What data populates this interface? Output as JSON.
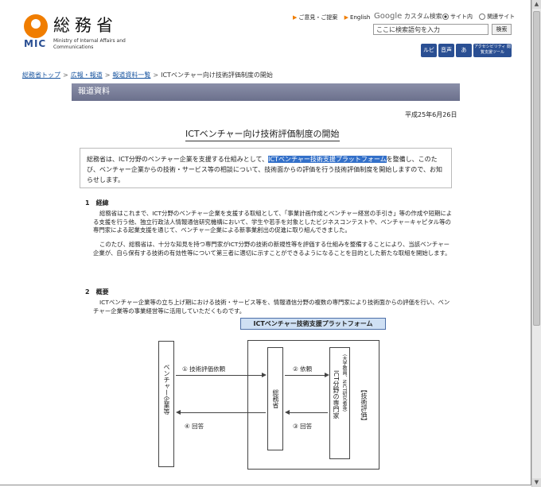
{
  "header": {
    "logo_jp": "総務省",
    "logo_mic": "MIC",
    "logo_en": "Ministry of Internal Affairs and Communications",
    "util_links": [
      "ご意見・ご提案",
      "English"
    ],
    "search_label_brand": "Google",
    "search_label_text": "カスタム検索",
    "radio_options": [
      "サイト内",
      "関連サイト"
    ],
    "search_placeholder": "ここに検索語句を入力",
    "search_button": "検索",
    "tools": [
      "ルビ",
      "音声",
      "あ",
      "アクセシビリティ 閲覧支援ツール"
    ]
  },
  "breadcrumb": [
    "総務省トップ",
    "広報・報道",
    "報道資料一覧",
    "ICTベンチャー向け技術評価制度の開始"
  ],
  "section_header": "報道資料",
  "date": "平成25年6月26日",
  "title": "ICTベンチャー向け技術評価制度の開始",
  "summary": {
    "before": "総務省は、ICT分野のベンチャー企業を支援する仕組みとして、",
    "highlight": "ICTベンチャー技術支援プラットフォーム",
    "after": "を整備し、このたび、ベンチャー企業からの技術・サービス等の相談について、技術面からの評価を行う技術評価制度を開始しますので、お知らせします。"
  },
  "sections": [
    {
      "heading": "1　経緯",
      "paragraphs": [
        "総務省はこれまで、ICT分野のベンチャー企業を支援する取組として、「事業計画作成とベンチャー経営の手引き」等の作成や短期による支援を行う他、独立行政法人情報通信研究機構において、学生や若手を対象としたビジネスコンテストや、ベンチャーキャピタル等の専門家による起業支援を通じて、ベンチャー企業による新事業創出の促進に取り組んできました。",
        "このたび、総務省は、十分な知見を持つ専門家がICT分野の技術の新規性等を評価する仕組みを整備することにより、当該ベンチャー企業が、自ら保有する技術の有効性等について第三者に適切に示すことができるようになることを目的とした新たな取組を開始します。"
      ]
    },
    {
      "heading": "2　概要",
      "paragraphs": [
        "ICTベンチャー企業等の立ち上げ期における技術・サービス等を、情報通信分野の複数の専門家により技術面からの評価を行い、ベンチャー企業等の事業経営等に活用していただくものです。"
      ]
    }
  ],
  "diagram": {
    "title": "ICTベンチャー技術支援プラットフォーム",
    "left_box": "ベンチャー企業等",
    "center_box": "総務省",
    "right_box": "ICT分野の専門家",
    "right_box_sub": "（大学教員、NICT研究者等）",
    "right_label": "【技術評価】",
    "arrow1": "① 技術評価依頼",
    "arrow2": "② 依頼",
    "arrow3": "③ 回答",
    "arrow4": "④ 回答"
  }
}
